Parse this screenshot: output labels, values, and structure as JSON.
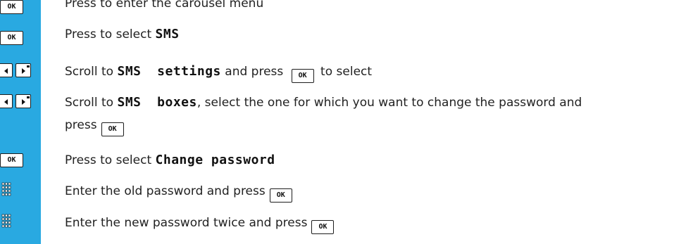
{
  "ok_label": "OK",
  "steps": [
    {
      "text": "Press to enter the carousel menu"
    },
    {
      "prefix": "Press to select ",
      "lcd": "SMS"
    },
    {
      "prefix": "Scroll to ",
      "lcd": "SMS  settings",
      "middle": " and press ",
      "suffix": " to select"
    },
    {
      "prefix": "Scroll to ",
      "lcd": "SMS  boxes",
      "line1_rest": ", select the one for which you want to change the password and",
      "line2_prefix": "press"
    },
    {
      "prefix": "Press to select ",
      "lcd": "Change password"
    },
    {
      "prefix": "Enter the old password and press"
    },
    {
      "prefix": "Enter the new password twice and press"
    }
  ],
  "icons": [
    "ok-key",
    "ok-key",
    "nav-keys",
    "nav-keys",
    "ok-key",
    "keypad",
    "keypad"
  ],
  "colors": {
    "sidebar": "#29a9e1",
    "text": "#222222"
  }
}
